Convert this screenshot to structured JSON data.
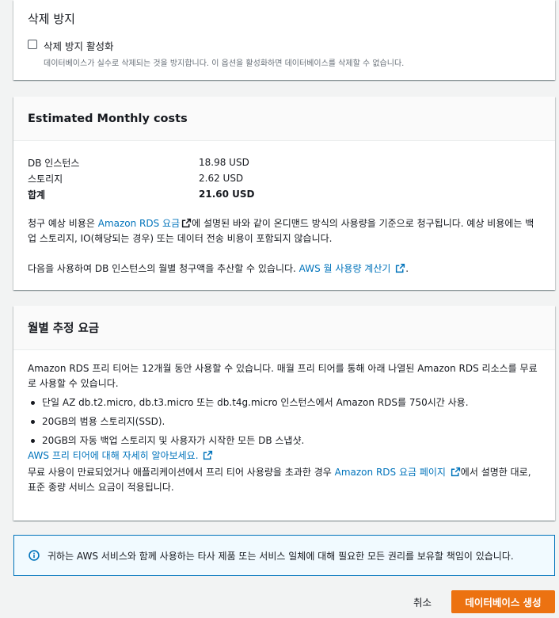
{
  "deletion_protection": {
    "title": "삭제 방지",
    "checkbox_label": "삭제 방지 활성화",
    "checkbox_checked": false,
    "description": "데이터베이스가 실수로 삭제되는 것을 방지합니다. 이 옵션을 활성화하면 데이터베이스를 삭제할 수 없습니다."
  },
  "estimated_costs": {
    "title": "Estimated Monthly costs",
    "rows": [
      {
        "label": "DB 인스턴스",
        "value": "18.98 USD"
      },
      {
        "label": "스토리지",
        "value": "2.62 USD"
      },
      {
        "label": "합계",
        "value": "21.60 USD"
      }
    ],
    "note_before_link": "청구 예상 비용은 ",
    "pricing_link": "Amazon RDS 요금",
    "note_after_link": "에 설명된 바와 같이 온디맨드 방식의 사용량을 기준으로 청구됩니다. 예상 비용에는 백업 스토리지, IO(해당되는 경우) 또는 데이터 전송 비용이 포함되지 않습니다.",
    "calc_before_link": "다음을 사용하여 DB 인스턴스의 월별 청구액을 추산할 수 있습니다. ",
    "calc_link": "AWS 월 사용량 계산기",
    "calc_after_link": "."
  },
  "monthly_estimate": {
    "title": "월별 추정 요금",
    "intro": "Amazon RDS 프리 티어는 12개월 동안 사용할 수 있습니다. 매월 프리 티어를 통해 아래 나열된 Amazon RDS 리소스를 무료로 사용할 수 있습니다.",
    "bullets": [
      "단일 AZ db.t2.micro, db.t3.micro 또는 db.t4g.micro 인스턴스에서 Amazon RDS를 750시간 사용.",
      "20GB의 범용 스토리지(SSD).",
      "20GB의 자동 백업 스토리지 및 사용자가 시작한 모든 DB 스냅샷."
    ],
    "learn_more_link": "AWS 프리 티어에 대해 자세히 알아보세요.",
    "expiry_before_link": "무료 사용이 만료되었거나 애플리케이션에서 프리 티어 사용량을 초과한 경우 ",
    "expiry_link": "Amazon RDS 요금 페이지",
    "expiry_after_link": "에서 설명한 대로, 표준 종량 서비스 요금이 적용됩니다."
  },
  "alert": {
    "text": "귀하는 AWS 서비스와 함께 사용하는 타사 제품 또는 서비스 일체에 대해 필요한 모든 권리를 보유할 책임이 있습니다."
  },
  "actions": {
    "cancel_label": "취소",
    "create_label": "데이터베이스 생성"
  },
  "colors": {
    "link": "#0073bb",
    "primary_button": "#ec7211",
    "alert_border": "#0073bb",
    "alert_bg": "#f1faff"
  }
}
